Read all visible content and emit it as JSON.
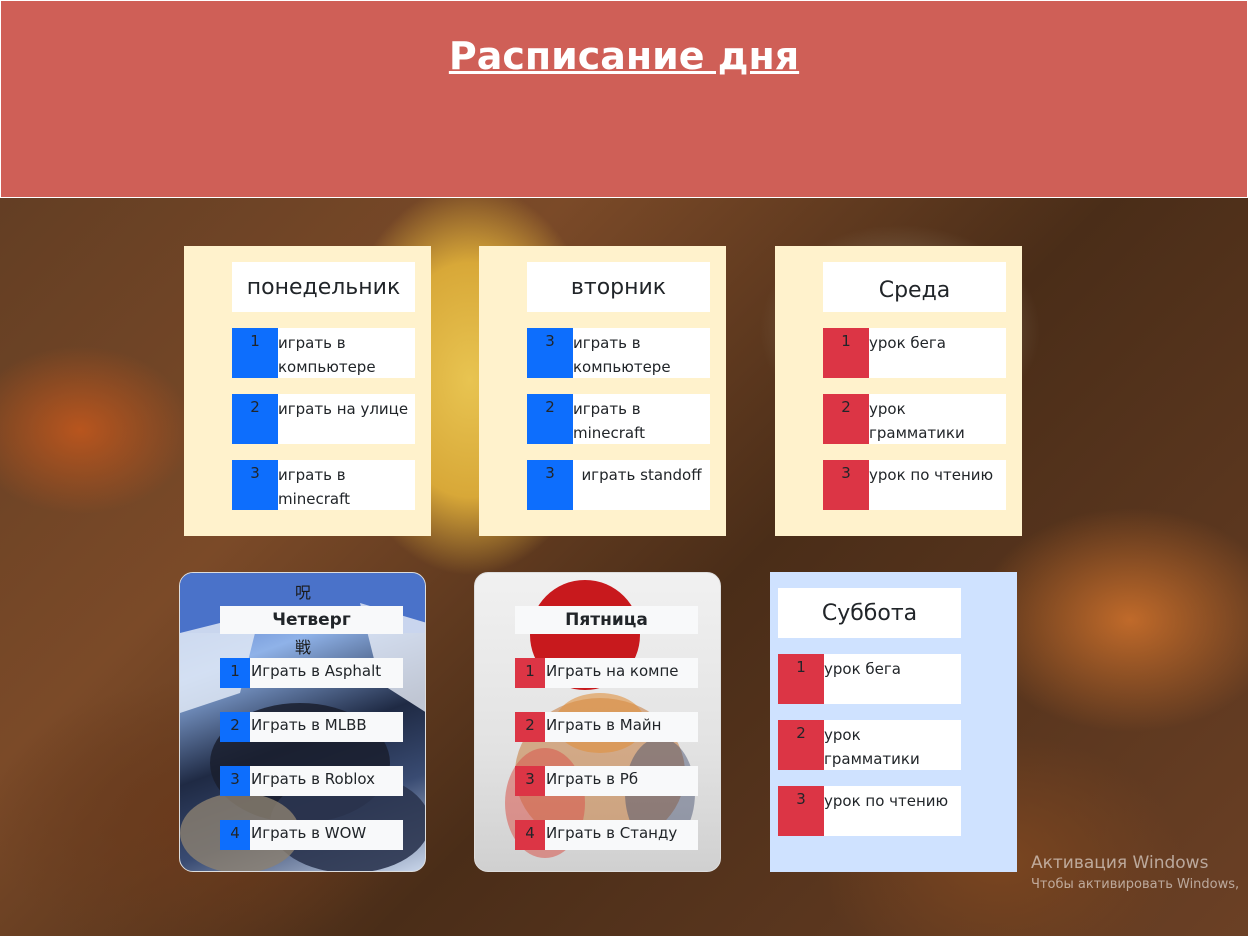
{
  "header": {
    "title": "Расписание дня"
  },
  "days": [
    {
      "name": "понедельник",
      "items": [
        {
          "num": "1",
          "text": "играть в компьютере"
        },
        {
          "num": "2",
          "text": "играть на улице"
        },
        {
          "num": "3",
          "text": "играть в minecraft"
        }
      ]
    },
    {
      "name": "вторник",
      "items": [
        {
          "num": "3",
          "text": "играть в компьютере"
        },
        {
          "num": "2",
          "text": "играть в minecraft"
        },
        {
          "num": "3",
          "text": "играть standoff"
        }
      ]
    },
    {
      "name": "Среда",
      "items": [
        {
          "num": "1",
          "text": "урок бега"
        },
        {
          "num": "2",
          "text": "урок грамматики"
        },
        {
          "num": "3",
          "text": "урок по чтению"
        }
      ]
    },
    {
      "name": "Четверг",
      "items": [
        {
          "num": "1",
          "text": "Играть в Asphalt"
        },
        {
          "num": "2",
          "text": "Играть в MLBB"
        },
        {
          "num": "3",
          "text": "Играть в Roblox"
        },
        {
          "num": "4",
          "text": "Играть в WOW"
        }
      ]
    },
    {
      "name": "Пятница",
      "items": [
        {
          "num": "1",
          "text": "Играть на компе"
        },
        {
          "num": "2",
          "text": "Играть в Майн"
        },
        {
          "num": "3",
          "text": "Играть в Рб"
        },
        {
          "num": "4",
          "text": "Играть в Станду"
        }
      ]
    },
    {
      "name": "Суббота",
      "items": [
        {
          "num": "1",
          "text": "урок бега"
        },
        {
          "num": "2",
          "text": "урок грамматики"
        },
        {
          "num": "3",
          "text": "урок по чтению"
        }
      ]
    }
  ],
  "watermark": {
    "line1": "Активация Windows",
    "line2": "Чтобы активировать Windows,"
  },
  "colors": {
    "header_bg": "#cf5f57",
    "card_cream": "#fff2cc",
    "card_blue": "#cfe2ff",
    "num_blue": "#0d6efd",
    "num_red": "#dc3545"
  }
}
